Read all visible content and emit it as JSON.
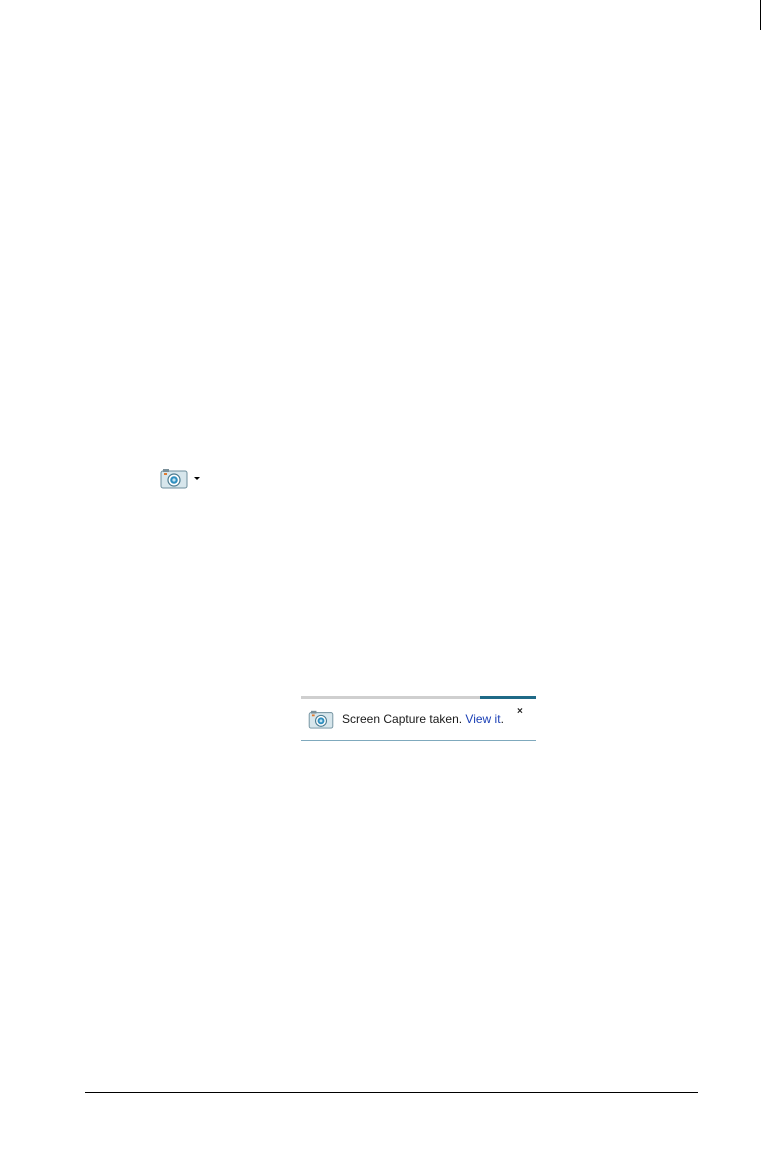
{
  "toolbar": {
    "capture_button": {
      "icon": "camera-icon",
      "dropdown_icon": "caret-down-icon"
    }
  },
  "toast": {
    "icon": "camera-icon",
    "message": "Screen Capture taken.",
    "link_text": "View it",
    "link_suffix": ".",
    "close_label": "×",
    "progress_fraction": 0.24,
    "colors": {
      "progress_track": "#cfcfcf",
      "progress_fill": "#1f6a87",
      "link": "#1a3fb5",
      "border": "#7fa9bd"
    }
  }
}
